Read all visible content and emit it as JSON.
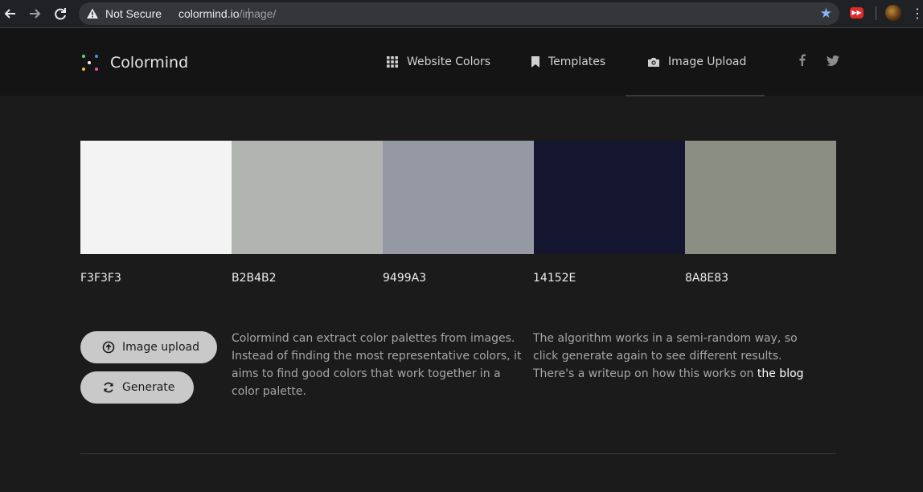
{
  "browser": {
    "security_label": "Not Secure",
    "url_host": "colormind.io",
    "url_path": "/image/",
    "icons": [
      "back-arrow-icon",
      "forward-arrow-icon",
      "reload-icon",
      "warning-icon",
      "bookmark-star-icon",
      "extension-icon",
      "profile-avatar",
      "more-icon"
    ]
  },
  "header": {
    "brand": "Colormind",
    "nav": [
      {
        "label": "Website Colors",
        "icon": "grid-icon"
      },
      {
        "label": "Templates",
        "icon": "bookmark-icon"
      },
      {
        "label": "Image Upload",
        "icon": "camera-icon",
        "active": true
      }
    ],
    "social": [
      {
        "glyph": "f",
        "icon": "facebook-icon"
      },
      {
        "glyph": "t",
        "icon": "twitter-icon"
      }
    ]
  },
  "palette": [
    {
      "hex": "F3F3F3",
      "color": "#F3F3F3"
    },
    {
      "hex": "B2B4B2",
      "color": "#B2B4B2"
    },
    {
      "hex": "9499A3",
      "color": "#9499A3"
    },
    {
      "hex": "14152E",
      "color": "#14152E"
    },
    {
      "hex": "8A8E83",
      "color": "#8A8E83"
    }
  ],
  "buttons": {
    "upload_label": "Image upload",
    "generate_label": "Generate"
  },
  "intro": {
    "lines": [
      "Colormind can extract color palettes from images.",
      "Instead of finding the most representative colors, it",
      "aims to find good colors that work together in a",
      "color palette."
    ]
  },
  "algorithm": {
    "line1": "The algorithm works in a semi-random way, so",
    "line2": "click generate again to see different results.",
    "line3_prefix": "There's a writeup on how this works on ",
    "link": "the blog"
  },
  "colors": {
    "page_bg": "#1b1b1b",
    "header_bg": "#141414",
    "button_bg": "#c9c9c9"
  }
}
